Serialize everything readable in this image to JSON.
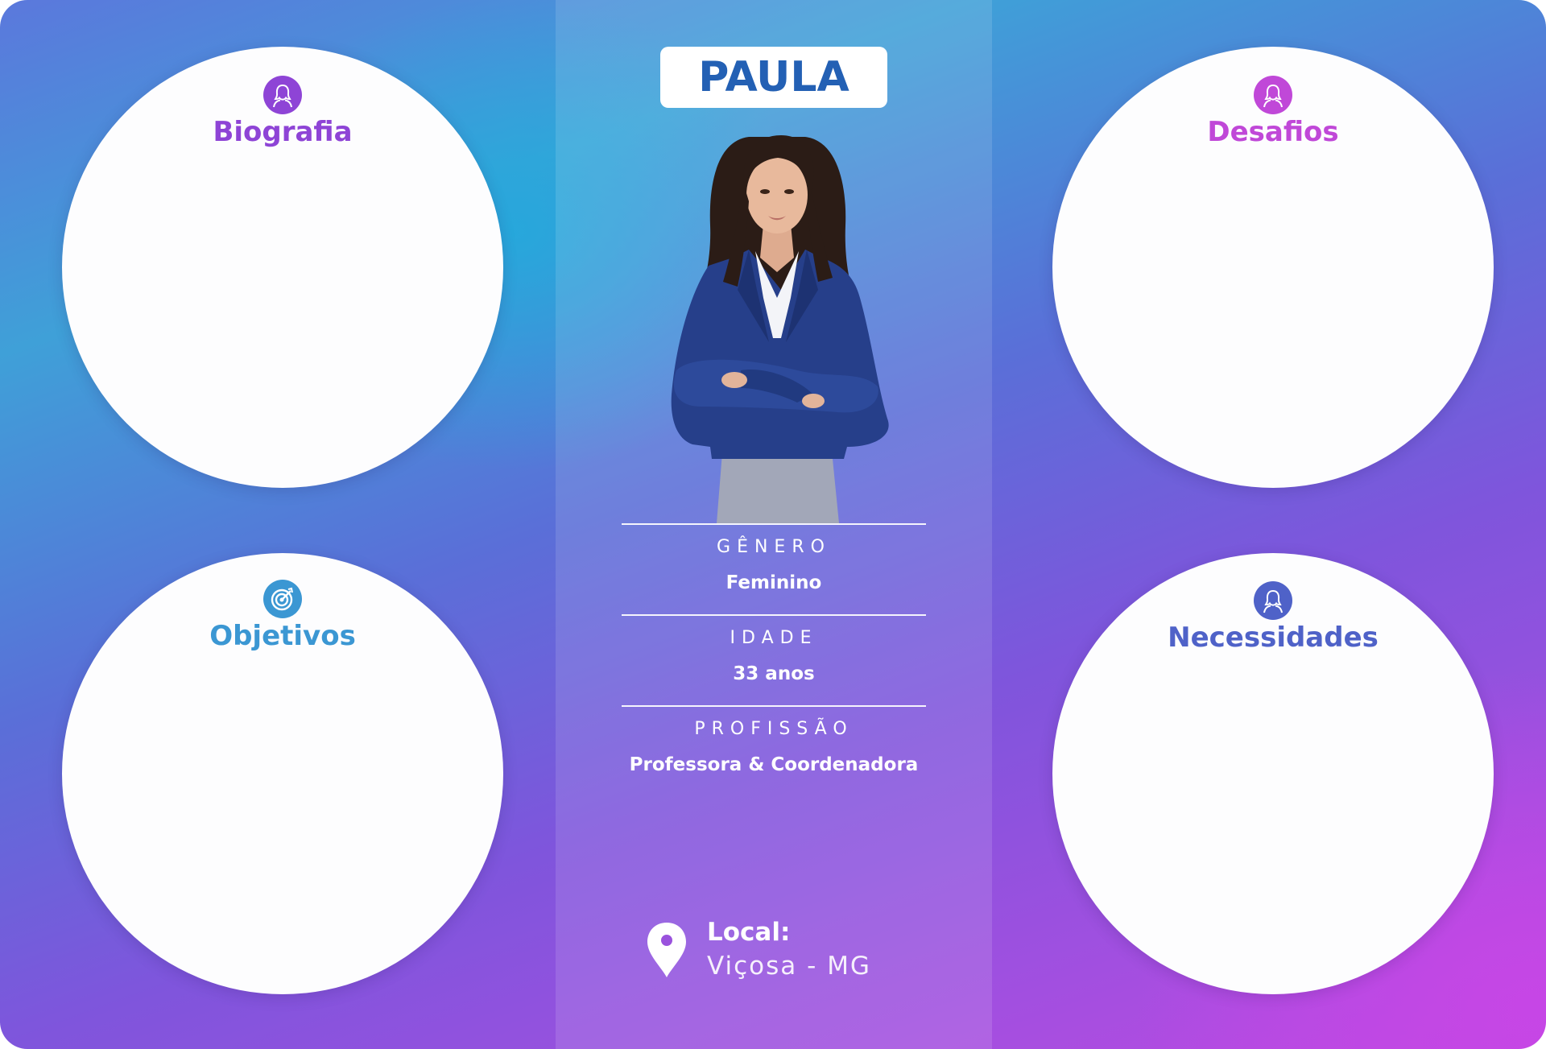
{
  "persona": {
    "name": "PAULA",
    "photo_alt": "portrait-of-woman-in-blue-blazer"
  },
  "sections": {
    "biografia": {
      "title": "Biografia",
      "icon": "user-female-icon",
      "color": "#8e44d6"
    },
    "desafios": {
      "title": "Desafios",
      "icon": "user-female-icon",
      "color": "#c048d8"
    },
    "objetivos": {
      "title": "Objetivos",
      "icon": "target-icon",
      "color": "#3b97d3"
    },
    "necessidades": {
      "title": "Necessidades",
      "icon": "user-female-icon",
      "color": "#4f62c8"
    }
  },
  "details": {
    "genero_label": "GÊNERO",
    "genero_value": "Feminino",
    "idade_label": "IDADE",
    "idade_value": "33 anos",
    "profissao_label": "PROFISSÃO",
    "profissao_value": "Professora & Coordenadora"
  },
  "location": {
    "label": "Local:",
    "value": "Viçosa - MG",
    "icon": "map-pin-icon"
  },
  "colors": {
    "name_text": "#2360b4",
    "panel_text": "#ffffff",
    "circle_bg": "#fdfdfe"
  }
}
